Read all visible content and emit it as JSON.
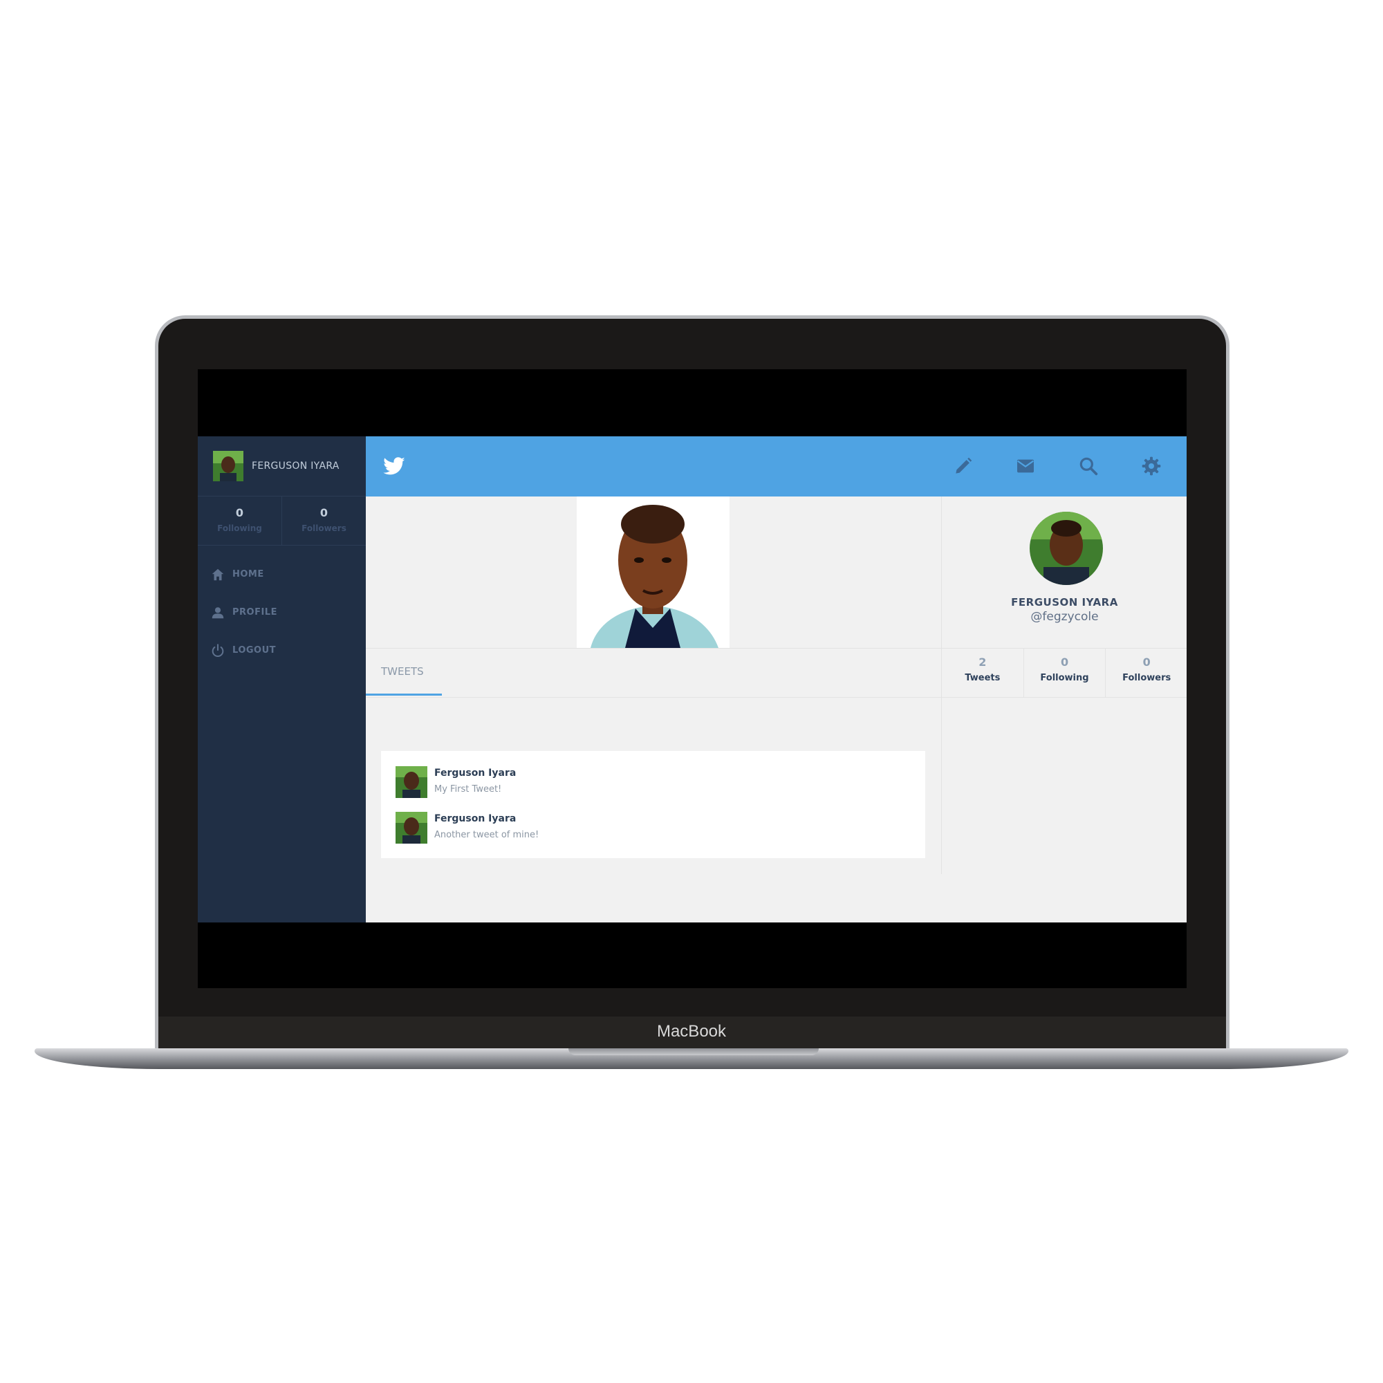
{
  "device": {
    "brand": "MacBook"
  },
  "sidebar": {
    "user_name": "FERGUSON IYARA",
    "stats": [
      {
        "value": "0",
        "label": "Following"
      },
      {
        "value": "0",
        "label": "Followers"
      }
    ],
    "nav": [
      {
        "label": "HOME",
        "icon": "home-icon"
      },
      {
        "label": "PROFILE",
        "icon": "person-icon"
      },
      {
        "label": "LOGOUT",
        "icon": "power-icon"
      }
    ]
  },
  "topbar": {
    "color": "#4fa3e3",
    "icons": [
      "twitter-bird-icon",
      "pencil-icon",
      "mail-icon",
      "search-icon",
      "gear-icon"
    ]
  },
  "tabs": [
    {
      "label": "TWEETS",
      "active": true
    }
  ],
  "tweets": [
    {
      "author": "Ferguson Iyara",
      "text": "My First Tweet!"
    },
    {
      "author": "Ferguson Iyara",
      "text": "Another tweet of mine!"
    }
  ],
  "profile_card": {
    "name": "FERGUSON IYARA",
    "handle": "@fegzycole",
    "stats": [
      {
        "value": "2",
        "label": "Tweets"
      },
      {
        "value": "0",
        "label": "Following"
      },
      {
        "value": "0",
        "label": "Followers"
      }
    ]
  }
}
